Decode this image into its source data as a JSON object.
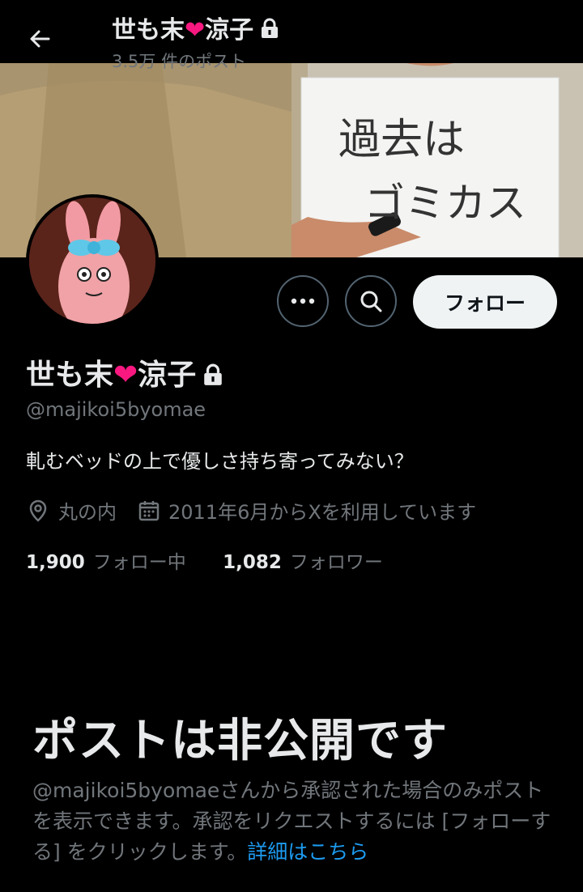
{
  "header": {
    "title_pre": "世も末",
    "title_heart": "❤",
    "title_post": "涼子",
    "post_count": "3.5万 件のポスト"
  },
  "banner": {
    "board_line1": "過去は",
    "board_line2": "ゴミカス"
  },
  "actions": {
    "follow_label": "フォロー"
  },
  "profile": {
    "name_pre": "世も末",
    "name_heart": "❤",
    "name_post": "涼子",
    "handle": "@majikoi5byomae",
    "bio": "軋むベッドの上で優しさ持ち寄ってみない？",
    "location": "丸の内",
    "joined": "2011年6月からXを利用しています",
    "following_count": "1,900",
    "following_label": "フォロー中",
    "followers_count": "1,082",
    "followers_label": "フォロワー"
  },
  "private_notice": {
    "title": "ポストは非公開です",
    "body": "@majikoi5byomaeさんから承認された場合のみポストを表示できます。承認をリクエストするには [フォローする] をクリックします。",
    "link": "詳細はこちら"
  },
  "colors": {
    "background": "#000000",
    "heart": "#f91880",
    "link": "#1d9bf0",
    "muted": "#71767b"
  }
}
